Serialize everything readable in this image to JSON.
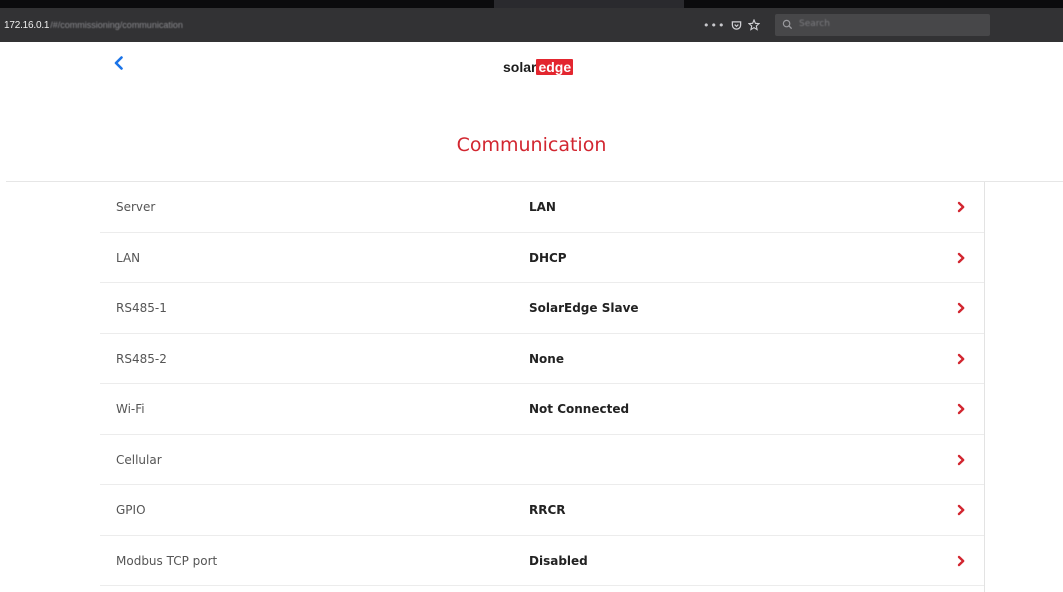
{
  "browser": {
    "url_host": "172.16.0.1",
    "url_path": "/#/commissioning/communication",
    "menu_dots": "•••",
    "search_placeholder": "Search"
  },
  "header": {
    "logo_solar": "solar",
    "logo_edge": "edge",
    "page_title": "Communication"
  },
  "rows": [
    {
      "label": "Server",
      "value": "LAN"
    },
    {
      "label": "LAN",
      "value": "DHCP"
    },
    {
      "label": "RS485-1",
      "value": "SolarEdge Slave"
    },
    {
      "label": "RS485-2",
      "value": "None"
    },
    {
      "label": "Wi-Fi",
      "value": "Not Connected"
    },
    {
      "label": "Cellular",
      "value": ""
    },
    {
      "label": "GPIO",
      "value": "RRCR"
    },
    {
      "label": "Modbus TCP port",
      "value": "Disabled"
    }
  ],
  "colors": {
    "accent_red": "#d22630",
    "back_blue": "#1a73e8",
    "browser_bar": "#323234"
  },
  "icons": {
    "back": "chevron-left-icon",
    "row_arrow": "chevron-right-icon",
    "pocket": "pocket-icon",
    "bookmark": "star-icon",
    "search": "search-icon"
  }
}
